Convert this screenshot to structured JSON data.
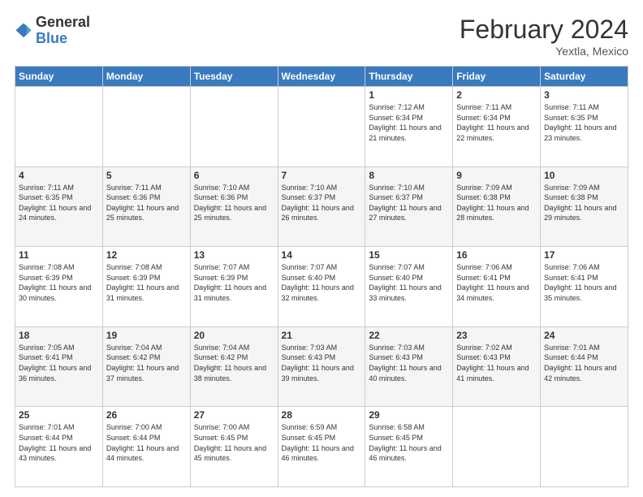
{
  "logo": {
    "general": "General",
    "blue": "Blue"
  },
  "header": {
    "month": "February 2024",
    "location": "Yextla, Mexico"
  },
  "days_of_week": [
    "Sunday",
    "Monday",
    "Tuesday",
    "Wednesday",
    "Thursday",
    "Friday",
    "Saturday"
  ],
  "weeks": [
    [
      {
        "day": "",
        "info": ""
      },
      {
        "day": "",
        "info": ""
      },
      {
        "day": "",
        "info": ""
      },
      {
        "day": "",
        "info": ""
      },
      {
        "day": "1",
        "info": "Sunrise: 7:12 AM\nSunset: 6:34 PM\nDaylight: 11 hours and 21 minutes."
      },
      {
        "day": "2",
        "info": "Sunrise: 7:11 AM\nSunset: 6:34 PM\nDaylight: 11 hours and 22 minutes."
      },
      {
        "day": "3",
        "info": "Sunrise: 7:11 AM\nSunset: 6:35 PM\nDaylight: 11 hours and 23 minutes."
      }
    ],
    [
      {
        "day": "4",
        "info": "Sunrise: 7:11 AM\nSunset: 6:35 PM\nDaylight: 11 hours and 24 minutes."
      },
      {
        "day": "5",
        "info": "Sunrise: 7:11 AM\nSunset: 6:36 PM\nDaylight: 11 hours and 25 minutes."
      },
      {
        "day": "6",
        "info": "Sunrise: 7:10 AM\nSunset: 6:36 PM\nDaylight: 11 hours and 25 minutes."
      },
      {
        "day": "7",
        "info": "Sunrise: 7:10 AM\nSunset: 6:37 PM\nDaylight: 11 hours and 26 minutes."
      },
      {
        "day": "8",
        "info": "Sunrise: 7:10 AM\nSunset: 6:37 PM\nDaylight: 11 hours and 27 minutes."
      },
      {
        "day": "9",
        "info": "Sunrise: 7:09 AM\nSunset: 6:38 PM\nDaylight: 11 hours and 28 minutes."
      },
      {
        "day": "10",
        "info": "Sunrise: 7:09 AM\nSunset: 6:38 PM\nDaylight: 11 hours and 29 minutes."
      }
    ],
    [
      {
        "day": "11",
        "info": "Sunrise: 7:08 AM\nSunset: 6:39 PM\nDaylight: 11 hours and 30 minutes."
      },
      {
        "day": "12",
        "info": "Sunrise: 7:08 AM\nSunset: 6:39 PM\nDaylight: 11 hours and 31 minutes."
      },
      {
        "day": "13",
        "info": "Sunrise: 7:07 AM\nSunset: 6:39 PM\nDaylight: 11 hours and 31 minutes."
      },
      {
        "day": "14",
        "info": "Sunrise: 7:07 AM\nSunset: 6:40 PM\nDaylight: 11 hours and 32 minutes."
      },
      {
        "day": "15",
        "info": "Sunrise: 7:07 AM\nSunset: 6:40 PM\nDaylight: 11 hours and 33 minutes."
      },
      {
        "day": "16",
        "info": "Sunrise: 7:06 AM\nSunset: 6:41 PM\nDaylight: 11 hours and 34 minutes."
      },
      {
        "day": "17",
        "info": "Sunrise: 7:06 AM\nSunset: 6:41 PM\nDaylight: 11 hours and 35 minutes."
      }
    ],
    [
      {
        "day": "18",
        "info": "Sunrise: 7:05 AM\nSunset: 6:41 PM\nDaylight: 11 hours and 36 minutes."
      },
      {
        "day": "19",
        "info": "Sunrise: 7:04 AM\nSunset: 6:42 PM\nDaylight: 11 hours and 37 minutes."
      },
      {
        "day": "20",
        "info": "Sunrise: 7:04 AM\nSunset: 6:42 PM\nDaylight: 11 hours and 38 minutes."
      },
      {
        "day": "21",
        "info": "Sunrise: 7:03 AM\nSunset: 6:43 PM\nDaylight: 11 hours and 39 minutes."
      },
      {
        "day": "22",
        "info": "Sunrise: 7:03 AM\nSunset: 6:43 PM\nDaylight: 11 hours and 40 minutes."
      },
      {
        "day": "23",
        "info": "Sunrise: 7:02 AM\nSunset: 6:43 PM\nDaylight: 11 hours and 41 minutes."
      },
      {
        "day": "24",
        "info": "Sunrise: 7:01 AM\nSunset: 6:44 PM\nDaylight: 11 hours and 42 minutes."
      }
    ],
    [
      {
        "day": "25",
        "info": "Sunrise: 7:01 AM\nSunset: 6:44 PM\nDaylight: 11 hours and 43 minutes."
      },
      {
        "day": "26",
        "info": "Sunrise: 7:00 AM\nSunset: 6:44 PM\nDaylight: 11 hours and 44 minutes."
      },
      {
        "day": "27",
        "info": "Sunrise: 7:00 AM\nSunset: 6:45 PM\nDaylight: 11 hours and 45 minutes."
      },
      {
        "day": "28",
        "info": "Sunrise: 6:59 AM\nSunset: 6:45 PM\nDaylight: 11 hours and 46 minutes."
      },
      {
        "day": "29",
        "info": "Sunrise: 6:58 AM\nSunset: 6:45 PM\nDaylight: 11 hours and 46 minutes."
      },
      {
        "day": "",
        "info": ""
      },
      {
        "day": "",
        "info": ""
      }
    ]
  ]
}
